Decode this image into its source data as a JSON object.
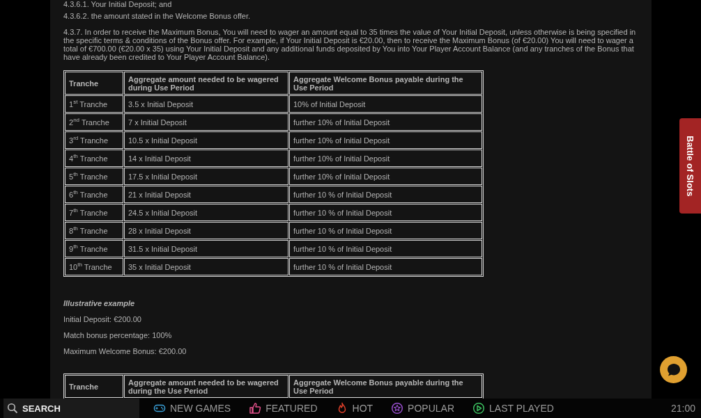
{
  "clauses": [
    "4.3.6.1. Your Initial Deposit; and",
    "4.3.6.2. the amount stated in the Welcome Bonus offer.",
    "4.3.7. In order to receive the Maximum Bonus, You will need to wager an amount equal to 35 times the value of Your Initial Deposit, unless otherwise is being specified in the specific terms & conditions of the Bonus offer. For example, if Your Initial Deposit is €20.00, then to receive the Maximum Bonus (of €20.00) You will need to wager a total of €700.00 (€20.00 x 35) using Your Initial Deposit and any additional funds deposited by You into Your Player Account Balance (and any tranches of the Bonus that have already been credited to Your Player Account Balance)."
  ],
  "tables": [
    {
      "columns": [
        "Tranche",
        "Aggregate amount needed to be wagered during Use Period",
        "Aggregate Welcome Bonus payable during the Use Period"
      ],
      "rows": [
        [
          "1$^{st}$ Tranche",
          "3.5 x Initial Deposit",
          "10% of Initial Deposit"
        ],
        [
          "2$^{nd}$ Tranche",
          "7 x Initial Deposit",
          "further 10% of Initial Deposit"
        ],
        [
          "3$^{rd}$ Tranche",
          "10.5 x Initial Deposit",
          "further 10% of Initial Deposit"
        ],
        [
          "4$^{th}$ Tranche",
          "14 x Initial Deposit",
          "further 10% of Initial Deposit"
        ],
        [
          "5$^{th}$ Tranche",
          "17.5 x Initial Deposit",
          "further 10% of Initial Deposit"
        ],
        [
          "6$^{th}$ Tranche",
          "21 x Initial Deposit",
          "further 10 % of Initial Deposit"
        ],
        [
          "7$^{th}$ Tranche",
          "24.5 x Initial Deposit",
          "further 10 % of Initial Deposit"
        ],
        [
          "8$^{th}$ Tranche",
          "28 x Initial Deposit",
          "further 10 % of Initial Deposit"
        ],
        [
          "9$^{th}$ Tranche",
          "31.5 x Initial Deposit",
          "further 10 % of Initial Deposit"
        ],
        [
          "10$^{th}$ Tranche",
          "35 x Initial Deposit",
          "further 10 % of Initial Deposit"
        ]
      ]
    },
    {
      "columns": [
        "Tranche",
        "Aggregate amount needed to be wagered during the Use Period",
        "Aggregate Welcome Bonus payable during the Use Period"
      ]
    }
  ],
  "example": {
    "title": "Illustrative example",
    "lines": [
      "Initial Deposit: €200.00",
      "Match bonus percentage: 100%",
      "Maximum Welcome Bonus: €200.00"
    ]
  },
  "side_tab": {
    "label": "Battle of Slots"
  },
  "bottom_nav": {
    "search": {
      "label": "SEARCH"
    },
    "items": [
      {
        "label": "NEW GAMES",
        "kind": "gamepad",
        "color": "#3aa0d8"
      },
      {
        "label": "FEATURED",
        "kind": "thumbs",
        "color": "#e0508a"
      },
      {
        "label": "HOT",
        "kind": "flame",
        "color": "#e0402a"
      },
      {
        "label": "POPULAR",
        "kind": "star",
        "color": "#9a4fd0"
      },
      {
        "label": "LAST PLAYED",
        "kind": "play",
        "color": "#3cc060"
      }
    ],
    "time": "21:00"
  }
}
